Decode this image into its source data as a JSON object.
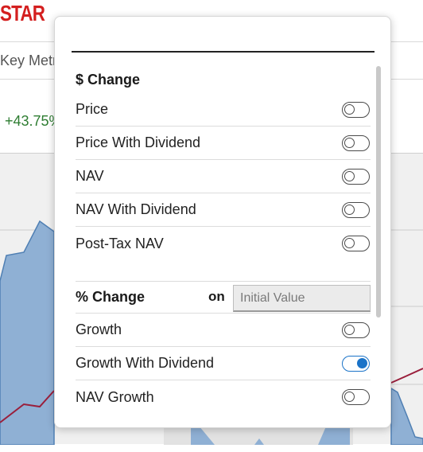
{
  "background": {
    "logo_fragment": "STAR",
    "tab_fragment": "Key Metr",
    "change_fragment": "+43.75%"
  },
  "panel": {
    "dollar_section": {
      "title": "$ Change",
      "items": [
        {
          "label": "Price",
          "on": false
        },
        {
          "label": "Price With Dividend",
          "on": false
        },
        {
          "label": "NAV",
          "on": false
        },
        {
          "label": "NAV With Dividend",
          "on": false
        },
        {
          "label": "Post-Tax NAV",
          "on": false
        }
      ]
    },
    "percent_section": {
      "title": "% Change",
      "on_label": "on",
      "input_placeholder": "Initial Value",
      "items": [
        {
          "label": "Growth",
          "on": false
        },
        {
          "label": "Growth With Dividend",
          "on": true
        },
        {
          "label": "NAV Growth",
          "on": false
        }
      ]
    }
  },
  "colors": {
    "accent": "#1a73c8",
    "logo_red": "#d41f1f",
    "positive_green": "#2e7d32",
    "chart_fill": "#8fb0d4",
    "chart_line": "#9a1f3c"
  }
}
